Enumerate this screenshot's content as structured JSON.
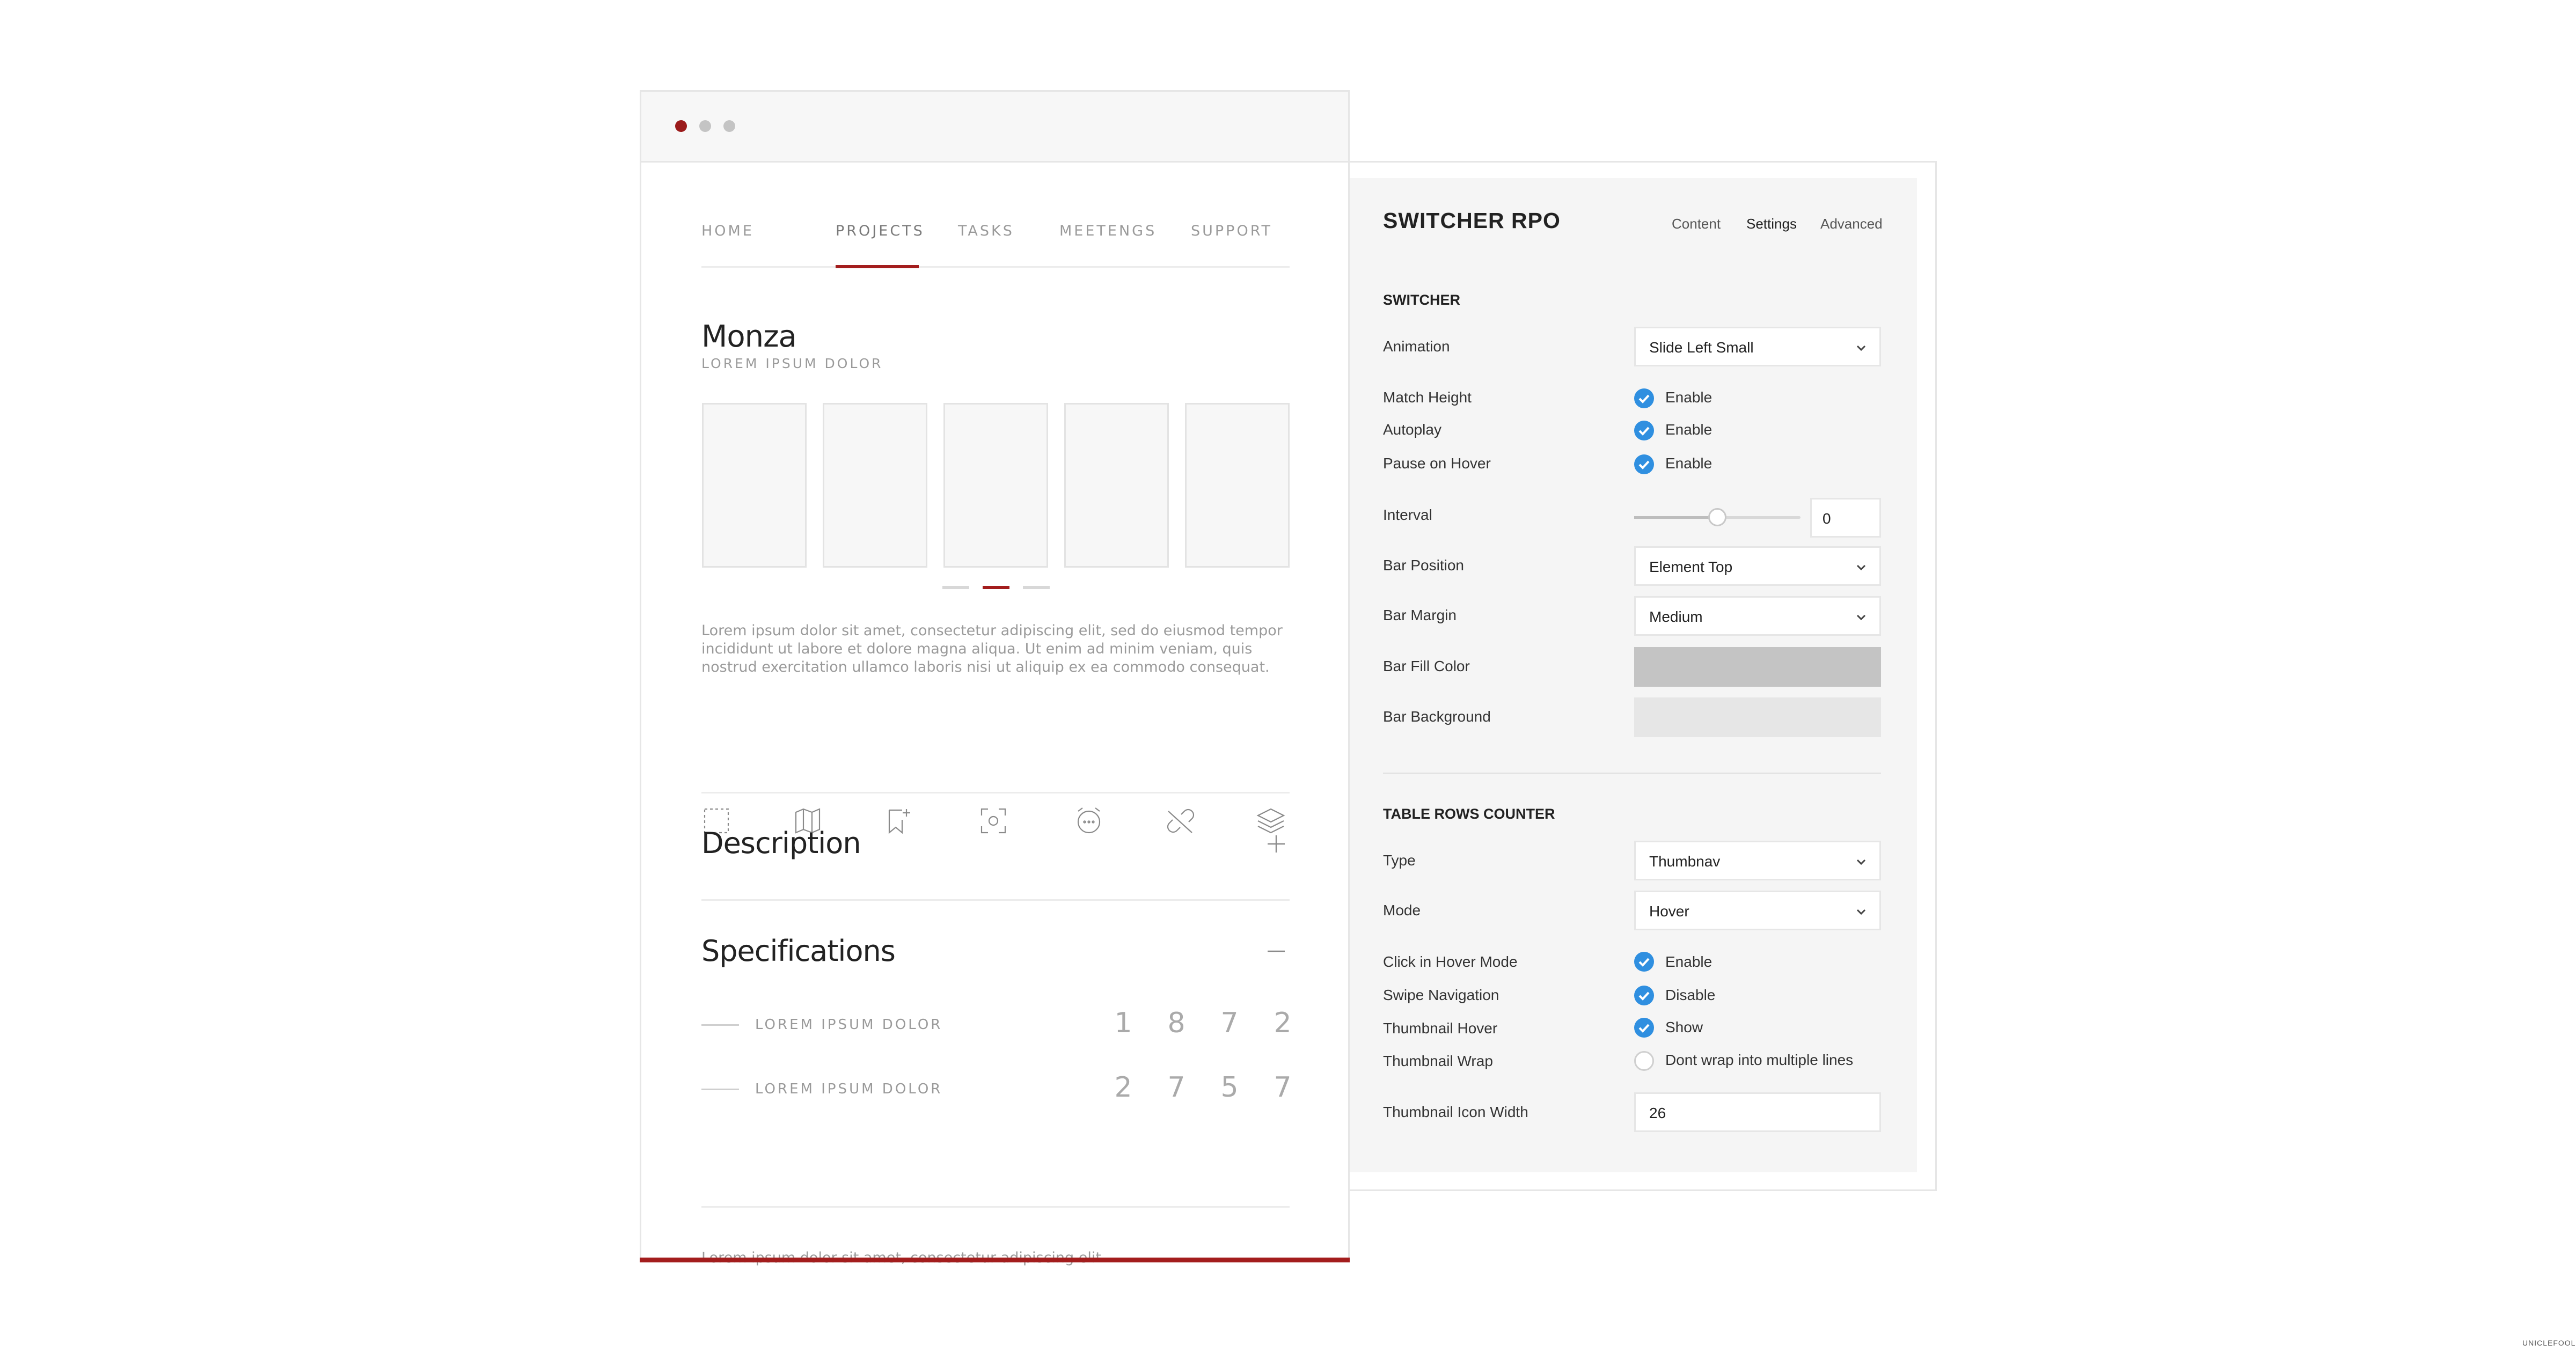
{
  "preview": {
    "nav": [
      "HOME",
      "PROJECTS",
      "TASKS",
      "MEETENGS",
      "SUPPORT"
    ],
    "active_nav": "PROJECTS",
    "title": "Monza",
    "subtitle": "LOREM IPSUM DOLOR",
    "slider_pages": 3,
    "slider_active_page": 2,
    "paragraph_lines": [
      "Lorem ipsum dolor sit amet, consectetur adipiscing elit, sed do eiusmod tempor",
      "incididunt ut labore et dolore magna aliqua. Ut enim ad minim veniam, quis",
      "nostrud exercitation ullamco laboris nisi ut aliquip ex ea commodo consequat."
    ],
    "icons": [
      "selection-icon",
      "map-icon",
      "bookmark-plus-icon",
      "focus-icon",
      "alarm-icon",
      "unlink-icon",
      "layers-icon"
    ],
    "accordion": [
      {
        "title": "Description",
        "state": "collapsed"
      },
      {
        "title": "Specifications",
        "state": "expanded"
      }
    ],
    "specs": [
      {
        "label": "LOREM IPSUM DOLOR",
        "digits": [
          "1",
          "8",
          "7",
          "2"
        ]
      },
      {
        "label": "LOREM IPSUM DOLOR",
        "digits": [
          "2",
          "7",
          "5",
          "7"
        ]
      }
    ],
    "footer_text": "Lorem ipsum dolor sit amet, consectetur adipiscing elit",
    "accent_color": "#a31d1d"
  },
  "panel": {
    "title": "SWITCHER RPO",
    "tabs": [
      "Content",
      "Settings",
      "Advanced"
    ],
    "active_tab": "Settings",
    "switcher": {
      "heading": "SWITCHER",
      "animation": {
        "label": "Animation",
        "value": "Slide Left Small"
      },
      "match_height": {
        "label": "Match Height",
        "option": "Enable",
        "checked": true
      },
      "autoplay": {
        "label": "Autoplay",
        "option": "Enable",
        "checked": true
      },
      "pause_on_hover": {
        "label": "Pause on Hover",
        "option": "Enable",
        "checked": true
      },
      "interval": {
        "label": "Interval",
        "value": "0",
        "slider_fraction": 0.5
      },
      "bar_position": {
        "label": "Bar Position",
        "value": "Element Top"
      },
      "bar_margin": {
        "label": "Bar Margin",
        "value": "Medium"
      },
      "bar_fill_color": {
        "label": "Bar Fill Color",
        "color": "#c4c4c4"
      },
      "bar_background": {
        "label": "Bar Background",
        "color": "#e6e6e6"
      }
    },
    "table_rows_counter": {
      "heading": "TABLE ROWS COUNTER",
      "type": {
        "label": "Type",
        "value": "Thumbnav"
      },
      "mode": {
        "label": "Mode",
        "value": "Hover"
      },
      "click_in_hover_mode": {
        "label": "Click in Hover Mode",
        "option": "Enable",
        "checked": true
      },
      "swipe_navigation": {
        "label": "Swipe Navigation",
        "option": "Disable",
        "checked": true
      },
      "thumbnail_hover": {
        "label": "Thumbnail Hover",
        "option": "Show",
        "checked": true
      },
      "thumbnail_wrap": {
        "label": "Thumbnail Wrap",
        "option": "Dont wrap into multiple lines",
        "checked": false
      },
      "thumbnail_icon_width": {
        "label": "Thumbnail Icon Width",
        "value": "26"
      }
    },
    "check_color": "#2f8fe0"
  },
  "watermark": "UNICLEFOOL"
}
